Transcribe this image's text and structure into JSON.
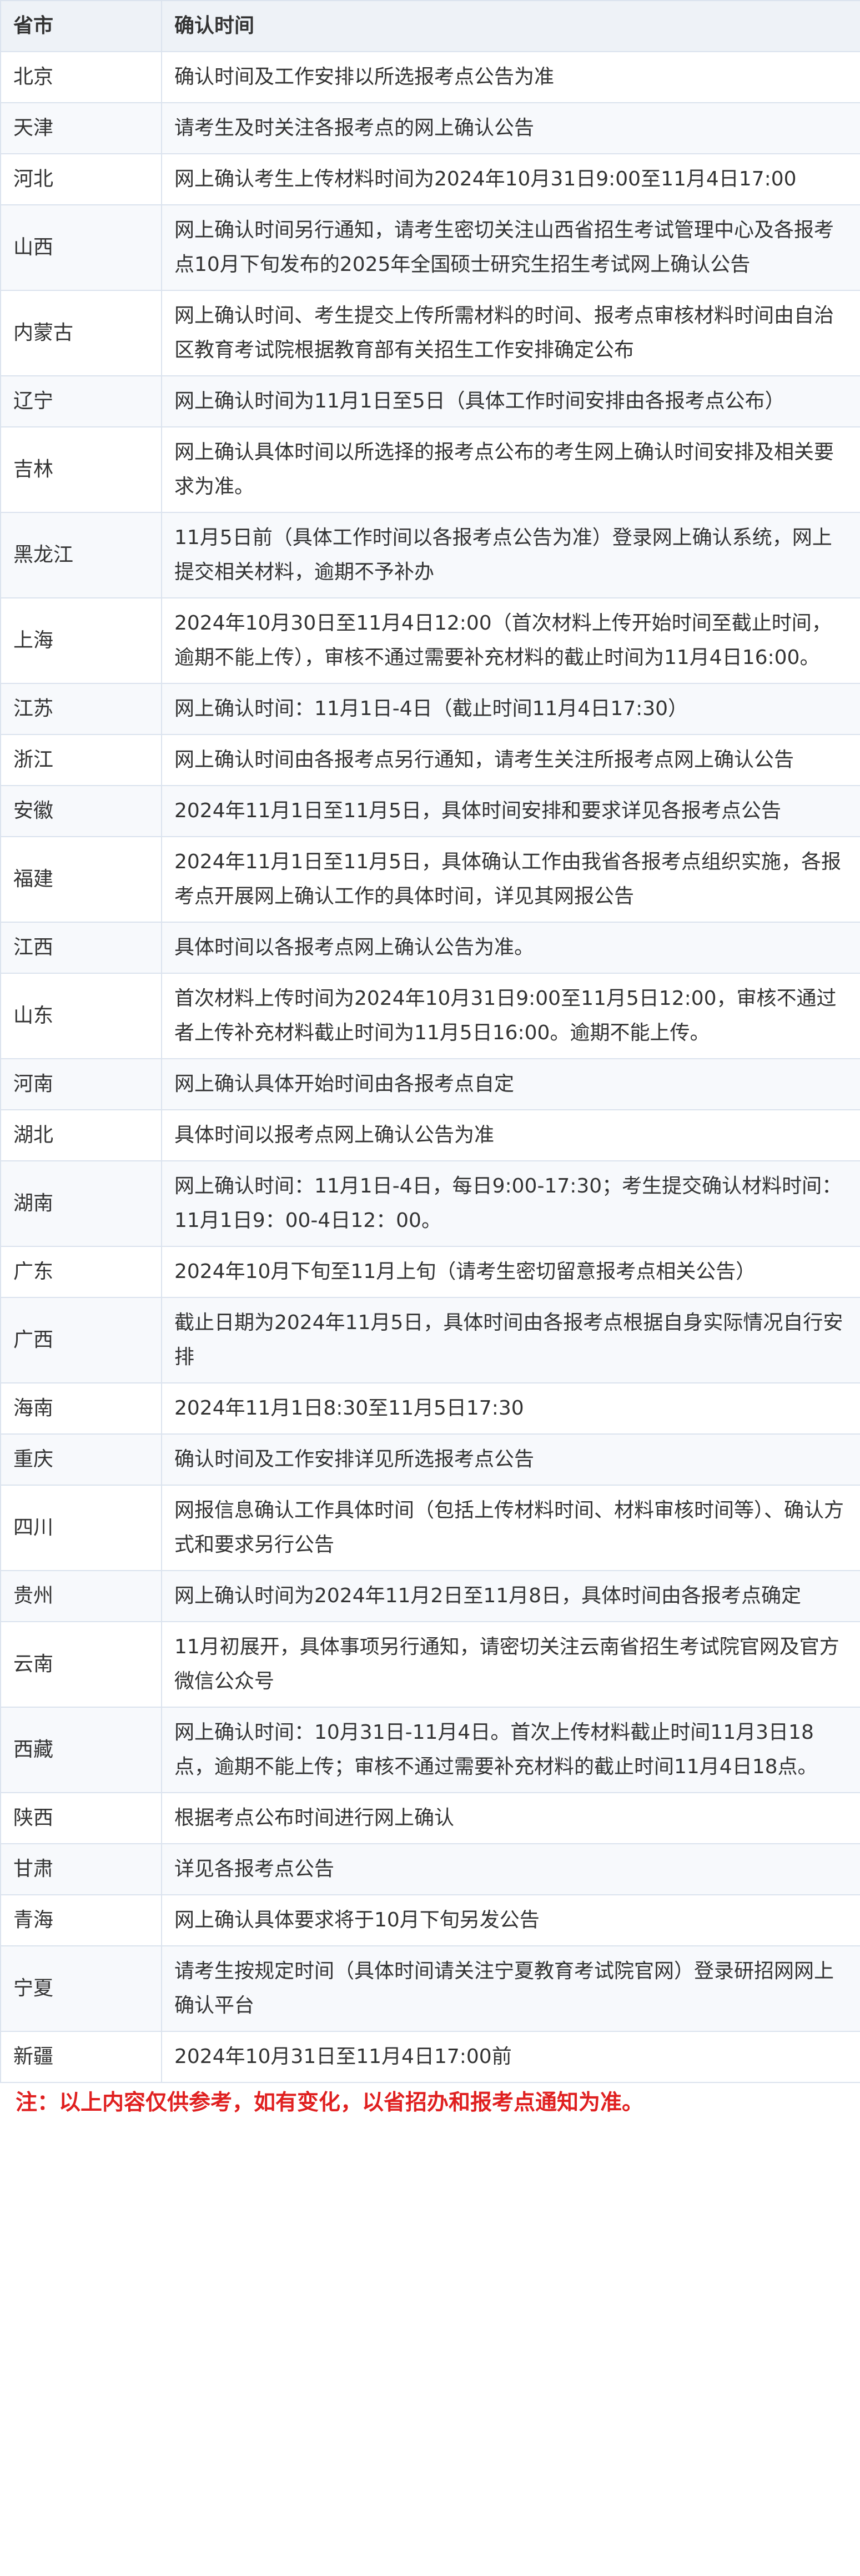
{
  "table": {
    "headers": [
      "省市",
      "确认时间"
    ],
    "rows": [
      [
        "北京",
        "确认时间及工作安排以所选报考点公告为准"
      ],
      [
        "天津",
        "请考生及时关注各报考点的网上确认公告"
      ],
      [
        "河北",
        "网上确认考生上传材料时间为2024年10月31日9:00至11月4日17:00"
      ],
      [
        "山西",
        "网上确认时间另行通知，请考生密切关注山西省招生考试管理中心及各报考点10月下旬发布的2025年全国硕士研究生招生考试网上确认公告"
      ],
      [
        "内蒙古",
        "网上确认时间、考生提交上传所需材料的时间、报考点审核材料时间由自治区教育考试院根据教育部有关招生工作安排确定公布"
      ],
      [
        "辽宁",
        "网上确认时间为11月1日至5日（具体工作时间安排由各报考点公布）"
      ],
      [
        "吉林",
        "网上确认具体时间以所选择的报考点公布的考生网上确认时间安排及相关要求为准。"
      ],
      [
        "黑龙江",
        "11月5日前（具体工作时间以各报考点公告为准）登录网上确认系统，网上提交相关材料，逾期不予补办"
      ],
      [
        "上海",
        "2024年10月30日至11月4日12:00（首次材料上传开始时间至截止时间，逾期不能上传），审核不通过需要补充材料的截止时间为11月4日16:00。"
      ],
      [
        "江苏",
        "网上确认时间：11月1日-4日（截止时间11月4日17:30）"
      ],
      [
        "浙江",
        "网上确认时间由各报考点另行通知，请考生关注所报考点网上确认公告"
      ],
      [
        "安徽",
        "2024年11月1日至11月5日，具体时间安排和要求详见各报考点公告"
      ],
      [
        "福建",
        "2024年11月1日至11月5日，具体确认工作由我省各报考点组织实施，各报考点开展网上确认工作的具体时间，详见其网报公告"
      ],
      [
        "江西",
        "具体时间以各报考点网上确认公告为准。"
      ],
      [
        "山东",
        "首次材料上传时间为2024年10月31日9:00至11月5日12:00，审核不通过者上传补充材料截止时间为11月5日16:00。逾期不能上传。"
      ],
      [
        "河南",
        "网上确认具体开始时间由各报考点自定"
      ],
      [
        "湖北",
        "具体时间以报考点网上确认公告为准"
      ],
      [
        "湖南",
        "网上确认时间：11月1日-4日，每日9:00-17:30；考生提交确认材料时间：11月1日9：00-4日12：00。"
      ],
      [
        "广东",
        "2024年10月下旬至11月上旬（请考生密切留意报考点相关公告）"
      ],
      [
        "广西",
        "截止日期为2024年11月5日，具体时间由各报考点根据自身实际情况自行安排"
      ],
      [
        "海南",
        "2024年11月1日8:30至11月5日17:30"
      ],
      [
        "重庆",
        "确认时间及工作安排详见所选报考点公告"
      ],
      [
        "四川",
        "网报信息确认工作具体时间（包括上传材料时间、材料审核时间等）、确认方式和要求另行公告"
      ],
      [
        "贵州",
        "网上确认时间为2024年11月2日至11月8日，具体时间由各报考点确定"
      ],
      [
        "云南",
        "11月初展开，具体事项另行通知，请密切关注云南省招生考试院官网及官方微信公众号"
      ],
      [
        "西藏",
        "网上确认时间：10月31日-11月4日。首次上传材料截止时间11月3日18点，逾期不能上传；审核不通过需要补充材料的截止时间11月4日18点。"
      ],
      [
        "陕西",
        "根据考点公布时间进行网上确认"
      ],
      [
        "甘肃",
        "详见各报考点公告"
      ],
      [
        "青海",
        "网上确认具体要求将于10月下旬另发公告"
      ],
      [
        "宁夏",
        "请考生按规定时间（具体时间请关注宁夏教育考试院官网）登录研招网网上确认平台"
      ],
      [
        "新疆",
        "2024年10月31日至11月4日17:00前"
      ]
    ]
  },
  "note": "注：以上内容仅供参考，如有变化，以省招办和报考点通知为准。",
  "colors": {
    "header_bg": "#eef2f7",
    "border": "#dbe3ee",
    "text": "#333333",
    "note": "#e02020"
  }
}
